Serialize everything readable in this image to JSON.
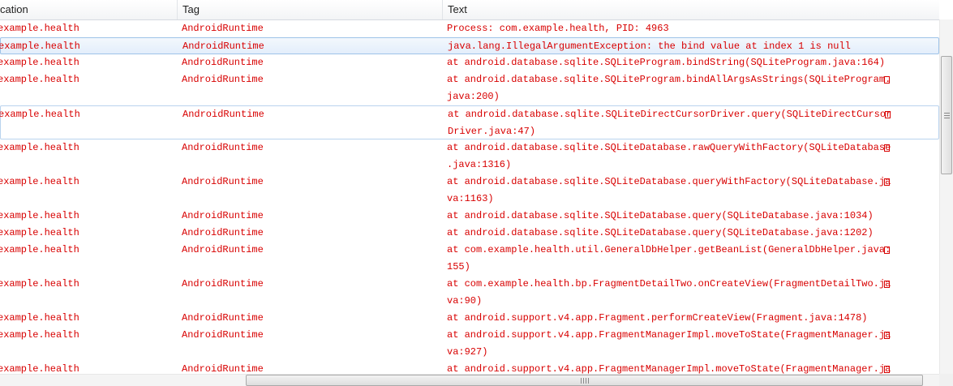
{
  "columns": [
    "cation",
    "Tag",
    "Text"
  ],
  "rows": [
    {
      "app": "example.health",
      "tag": "AndroidRuntime",
      "lines": [
        "Process: com.example.health, PID: 4963"
      ],
      "wrap": false
    },
    {
      "app": "example.health",
      "tag": "AndroidRuntime",
      "lines": [
        "java.lang.IllegalArgumentException: the bind value at index 1 is null"
      ],
      "wrap": false,
      "selected": true
    },
    {
      "app": "example.health",
      "tag": "AndroidRuntime",
      "lines": [
        "at android.database.sqlite.SQLiteProgram.bindString(SQLiteProgram.java:164)"
      ],
      "wrap": false
    },
    {
      "app": "example.health",
      "tag": "AndroidRuntime",
      "lines": [
        "at android.database.sqlite.SQLiteProgram.bindAllArgsAsStrings(SQLiteProgram.",
        "java:200)"
      ],
      "wrap": true
    },
    {
      "app": "example.health",
      "tag": "AndroidRuntime",
      "lines": [
        "at android.database.sqlite.SQLiteDirectCursorDriver.query(SQLiteDirectCursor",
        "Driver.java:47)"
      ],
      "wrap": true,
      "focus": true
    },
    {
      "app": "example.health",
      "tag": "AndroidRuntime",
      "lines": [
        "at android.database.sqlite.SQLiteDatabase.rawQueryWithFactory(SQLiteDatabase",
        ".java:1316)"
      ],
      "wrap": true
    },
    {
      "app": "example.health",
      "tag": "AndroidRuntime",
      "lines": [
        "at android.database.sqlite.SQLiteDatabase.queryWithFactory(SQLiteDatabase.ja",
        "va:1163)"
      ],
      "wrap": true
    },
    {
      "app": "example.health",
      "tag": "AndroidRuntime",
      "lines": [
        "at android.database.sqlite.SQLiteDatabase.query(SQLiteDatabase.java:1034)"
      ],
      "wrap": false
    },
    {
      "app": "example.health",
      "tag": "AndroidRuntime",
      "lines": [
        "at android.database.sqlite.SQLiteDatabase.query(SQLiteDatabase.java:1202)"
      ],
      "wrap": false
    },
    {
      "app": "example.health",
      "tag": "AndroidRuntime",
      "lines": [
        "at com.example.health.util.GeneralDbHelper.getBeanList(GeneralDbHelper.java:",
        "155)"
      ],
      "wrap": true
    },
    {
      "app": "example.health",
      "tag": "AndroidRuntime",
      "lines": [
        "at com.example.health.bp.FragmentDetailTwo.onCreateView(FragmentDetailTwo.ja",
        "va:90)"
      ],
      "wrap": true
    },
    {
      "app": "example.health",
      "tag": "AndroidRuntime",
      "lines": [
        "at android.support.v4.app.Fragment.performCreateView(Fragment.java:1478)"
      ],
      "wrap": false
    },
    {
      "app": "example.health",
      "tag": "AndroidRuntime",
      "lines": [
        "at android.support.v4.app.FragmentManagerImpl.moveToState(FragmentManager.ja",
        "va:927)"
      ],
      "wrap": true
    },
    {
      "app": "example.health",
      "tag": "AndroidRuntime",
      "lines": [
        "at android.support.v4.app.FragmentManagerImpl.moveToState(FragmentManager.ja",
        ""
      ],
      "wrap": true
    }
  ],
  "colors": {
    "log_text": "#d80000",
    "selection_border": "#9ec3e8"
  }
}
